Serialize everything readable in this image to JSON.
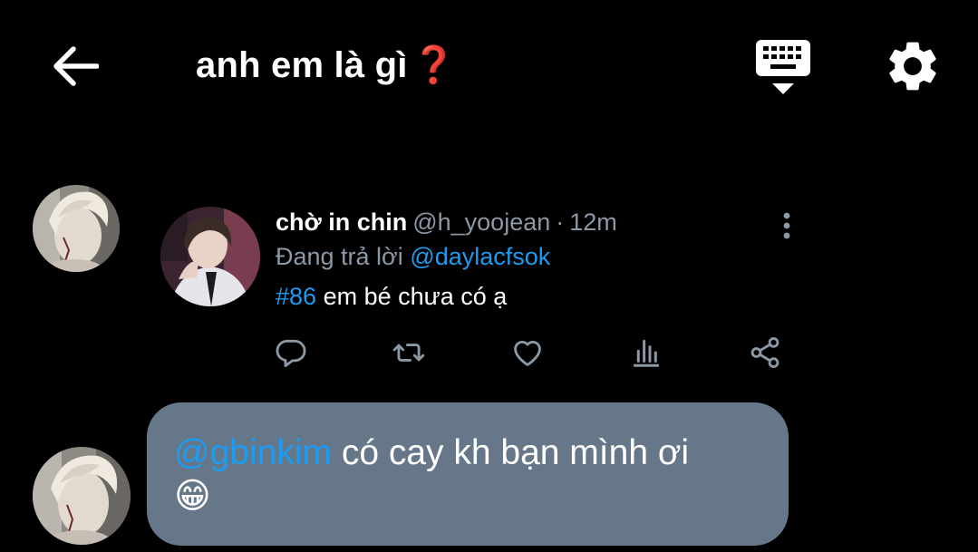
{
  "header": {
    "title": "anh em là gì",
    "title_emoji": "❓",
    "back_icon": "arrow-left-icon",
    "keyboard_icon": "keyboard-icon",
    "settings_icon": "gear-icon"
  },
  "tweet": {
    "name": "chờ in chin",
    "handle": "@h_yoojean",
    "separator": "·",
    "time": "12m",
    "replying_prefix": "Đang trả lời",
    "replying_to": "@daylacfsok",
    "hashtag": "#86",
    "text": " em bé chưa có ạ",
    "actions": [
      "reply-icon",
      "retweet-icon",
      "like-icon",
      "analytics-icon",
      "share-icon"
    ]
  },
  "reply_bubble": {
    "mention": "@gbinkim",
    "text": " có cay kh bạn mình ơi",
    "emoji": "😁"
  },
  "colors": {
    "background": "#000000",
    "accent": "#1d9bf0",
    "muted": "#8b98a5",
    "bubble": "#66778a",
    "title_emoji": "#e0202a"
  }
}
